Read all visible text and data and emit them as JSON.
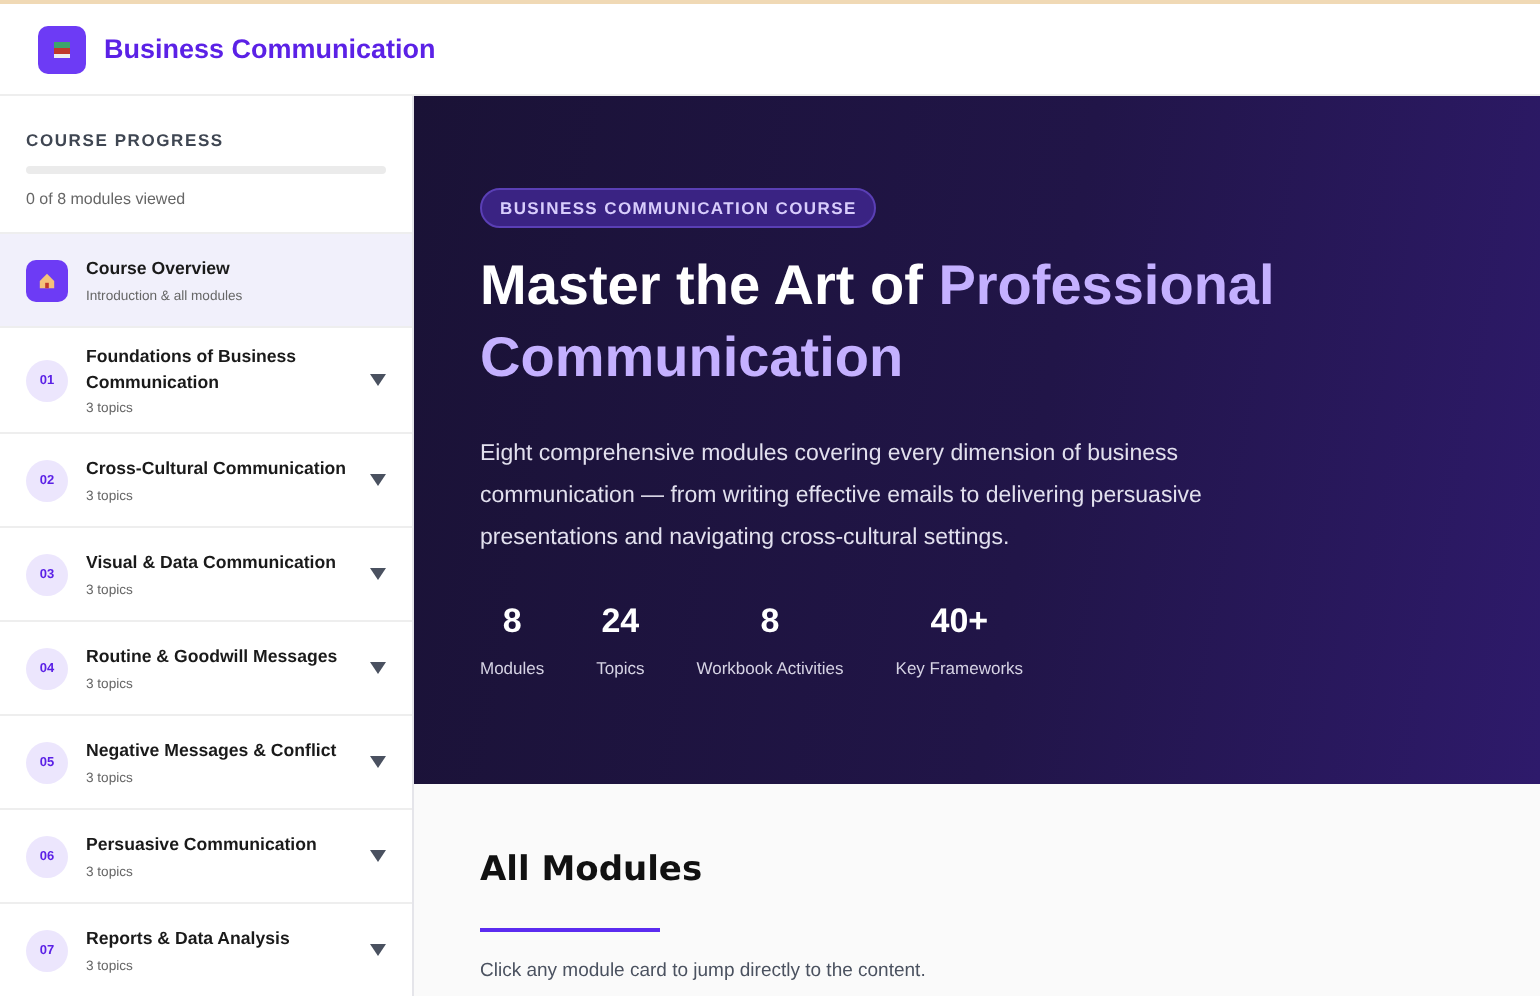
{
  "header": {
    "title": "Business Communication"
  },
  "sidebar": {
    "progress_title": "COURSE PROGRESS",
    "progress": {
      "level": 0
    },
    "progress_text": "0 of 8 modules viewed",
    "overview": {
      "title": "Course Overview",
      "subtitle": "Introduction & all modules",
      "selected": true
    },
    "modules": [
      {
        "number": "01",
        "title": "Foundations of Business Communication",
        "topics": "3 topics",
        "expanded": false
      },
      {
        "number": "02",
        "title": "Cross-Cultural Communication",
        "topics": "3 topics",
        "expanded": false
      },
      {
        "number": "03",
        "title": "Visual & Data Communication",
        "topics": "3 topics",
        "expanded": false
      },
      {
        "number": "04",
        "title": "Routine & Goodwill Messages",
        "topics": "3 topics",
        "expanded": false
      },
      {
        "number": "05",
        "title": "Negative Messages & Conflict",
        "topics": "3 topics",
        "expanded": false
      },
      {
        "number": "06",
        "title": "Persuasive Communication",
        "topics": "3 topics",
        "expanded": false
      },
      {
        "number": "07",
        "title": "Reports & Data Analysis",
        "topics": "3 topics",
        "expanded": false
      }
    ]
  },
  "hero": {
    "badge": "BUSINESS COMMUNICATION COURSE",
    "title": "Master the Art of",
    "title_highlight": "Professional Communication",
    "description": "Eight comprehensive modules covering every dimension of business communication — from writing effective emails to delivering persuasive presentations and navigating cross-cultural settings.",
    "stats": [
      {
        "value": "8",
        "label": "Modules"
      },
      {
        "value": "24",
        "label": "Topics"
      },
      {
        "value": "8",
        "label": "Workbook Activities"
      },
      {
        "value": "40+",
        "label": "Key Frameworks"
      }
    ]
  },
  "modules_section": {
    "title": "All Modules",
    "subtitle": "Click any module card to jump directly to the content."
  }
}
